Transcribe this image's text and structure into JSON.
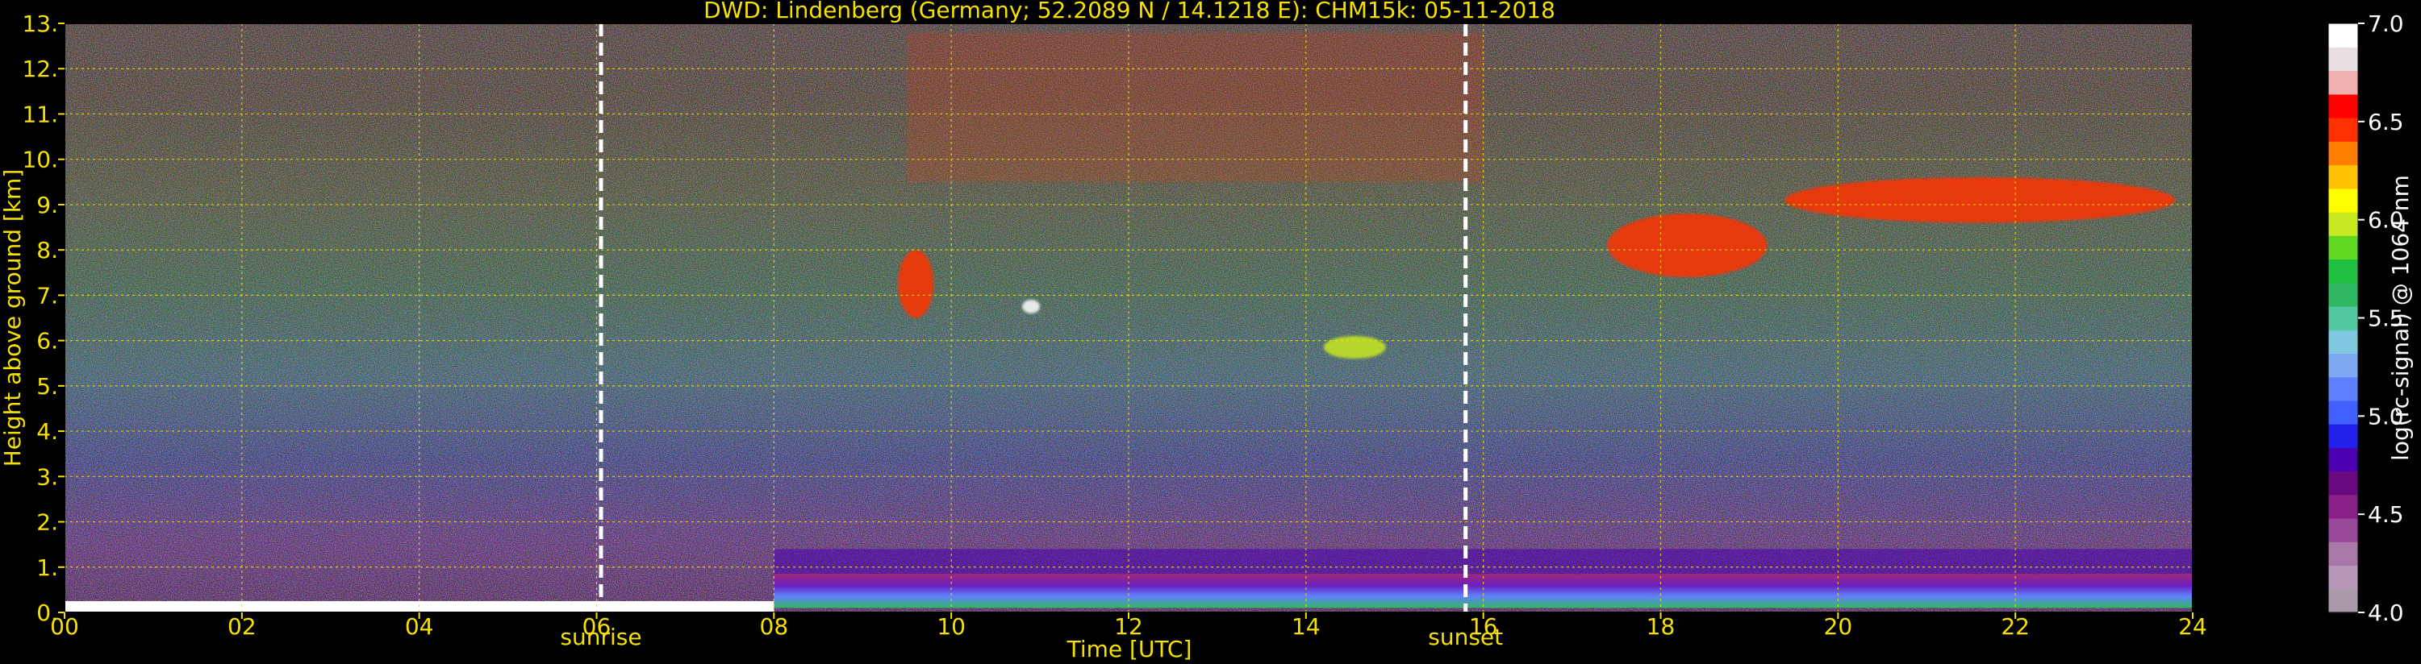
{
  "chart_data": {
    "type": "heatmap",
    "title": "DWD: Lindenberg (Germany; 52.2089 N / 14.1218 E):    CHM15k: 05-11-2018",
    "xlabel": "Time [UTC]",
    "ylabel": "Height above ground [km]",
    "xlim": [
      0,
      24
    ],
    "ylim": [
      0,
      13
    ],
    "x_ticks": [
      0,
      2,
      4,
      6,
      8,
      10,
      12,
      14,
      16,
      18,
      20,
      22,
      24
    ],
    "x_tick_labels": [
      "00",
      "02",
      "04",
      "06",
      "08",
      "10",
      "12",
      "14",
      "16",
      "18",
      "20",
      "22",
      "24"
    ],
    "y_ticks": [
      0,
      1,
      2,
      3,
      4,
      5,
      6,
      7,
      8,
      9,
      10,
      11,
      12,
      13
    ],
    "y_tick_labels": [
      "0.",
      "1.",
      "2.",
      "3.",
      "4.",
      "5.",
      "6.",
      "7.",
      "8.",
      "9.",
      "10.",
      "11.",
      "12.",
      "13."
    ],
    "grid": true,
    "markers": [
      {
        "label": "sunrise",
        "x": 6.05
      },
      {
        "label": "sunset",
        "x": 15.8
      }
    ],
    "colorbar": {
      "label": "log(rc-signal) @ 1064 nm",
      "range": [
        4.0,
        7.0
      ],
      "ticks": [
        4.0,
        4.5,
        5.0,
        5.5,
        6.0,
        6.5,
        7.0
      ],
      "tick_labels": [
        "4.0",
        "4.5",
        "5.0",
        "5.5",
        "6.0",
        "6.5",
        "7.0"
      ],
      "colors": [
        "#a89aa8",
        "#b898b8",
        "#a878a8",
        "#984898",
        "#882088",
        "#6a0a80",
        "#4a00b0",
        "#2020e8",
        "#4060ff",
        "#6080ff",
        "#80a8f0",
        "#80c8e0",
        "#50c8a0",
        "#30b860",
        "#20c040",
        "#60d820",
        "#c8e820",
        "#ffff00",
        "#ffc000",
        "#ff8000",
        "#ff3000",
        "#ff0000",
        "#f0b0b0",
        "#e8e0e0",
        "#ffffff"
      ]
    },
    "features": [
      {
        "kind": "boundary-layer",
        "x_start": 8.0,
        "x_end": 24.0,
        "y_bottom": 0.1,
        "y_top": 0.85,
        "level": 5.4
      },
      {
        "kind": "residual-layer",
        "x_start": 8.0,
        "x_end": 24.0,
        "y_bottom": 0.85,
        "y_top": 1.4,
        "level": 4.8
      },
      {
        "kind": "low-layer",
        "x_start": 0.0,
        "x_end": 8.0,
        "y_bottom": 0.0,
        "y_top": 0.25,
        "level": 7.0
      },
      {
        "kind": "cloud",
        "x_start": 9.4,
        "x_end": 9.8,
        "y_bottom": 6.5,
        "y_top": 8.0,
        "level": 6.5
      },
      {
        "kind": "cloud",
        "x_start": 10.8,
        "x_end": 11.0,
        "y_bottom": 6.6,
        "y_top": 6.9,
        "level": 7.0
      },
      {
        "kind": "cloud",
        "x_start": 14.2,
        "x_end": 14.9,
        "y_bottom": 5.6,
        "y_top": 6.1,
        "level": 6.0
      },
      {
        "kind": "cloud",
        "x_start": 17.4,
        "x_end": 19.2,
        "y_bottom": 7.4,
        "y_top": 8.8,
        "level": 6.5
      },
      {
        "kind": "cloud",
        "x_start": 19.4,
        "x_end": 23.8,
        "y_bottom": 8.6,
        "y_top": 9.6,
        "level": 6.5
      },
      {
        "kind": "cirrus",
        "x_start": 9.5,
        "x_end": 16.0,
        "y_bottom": 9.5,
        "y_top": 12.8,
        "level": 6.5
      }
    ]
  }
}
